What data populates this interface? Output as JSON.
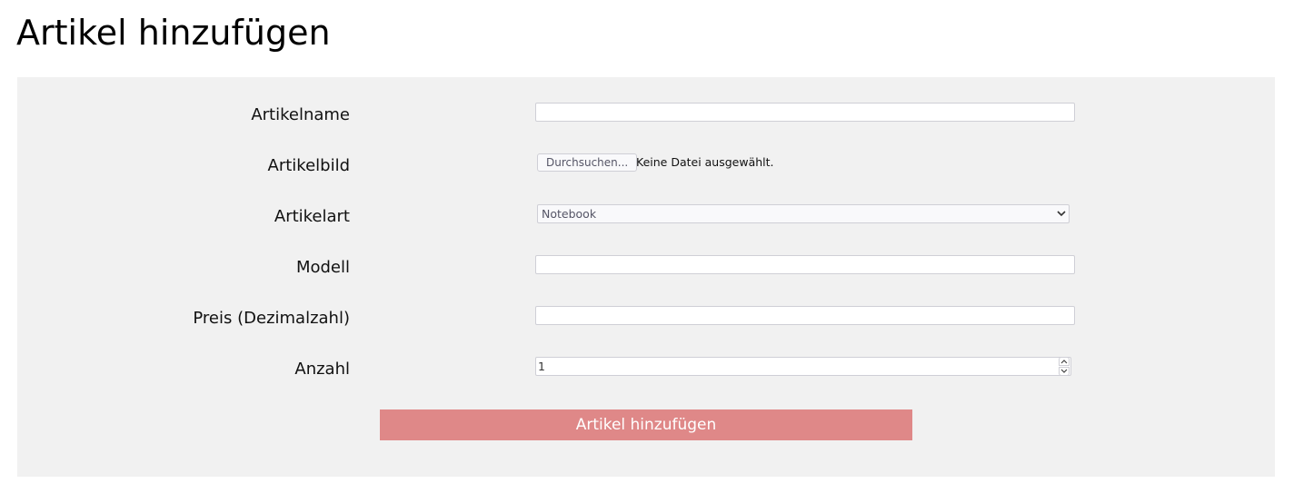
{
  "page": {
    "title": "Artikel hinzufügen"
  },
  "form": {
    "fields": {
      "name": {
        "label": "Artikelname",
        "value": ""
      },
      "image": {
        "label": "Artikelbild",
        "button_label": "Durchsuchen...",
        "status_text": "Keine Datei ausgewählt."
      },
      "type": {
        "label": "Artikelart",
        "selected": "Notebook"
      },
      "model": {
        "label": "Modell",
        "value": ""
      },
      "price": {
        "label": "Preis (Dezimalzahl)",
        "value": ""
      },
      "quantity": {
        "label": "Anzahl",
        "value": "1"
      }
    },
    "submit_label": "Artikel hinzufügen"
  },
  "colors": {
    "panel_background": "#f1f1f1",
    "submit_button": "#df8888",
    "submit_text": "#ffffff"
  },
  "icons": {
    "select_arrow": "chevron-down-icon",
    "spin_up": "chevron-up-icon",
    "spin_down": "chevron-down-icon"
  }
}
